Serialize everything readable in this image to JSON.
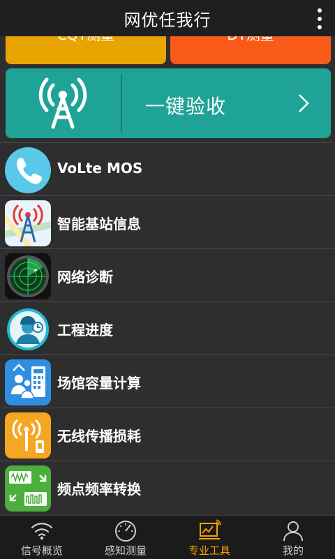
{
  "titlebar": {
    "title": "网优任我行",
    "menu_icon": "more-vert-icon"
  },
  "tiles": [
    {
      "label": "CQT测量",
      "color": "#e8a400"
    },
    {
      "label": "DT测量",
      "color": "#f85a1a"
    }
  ],
  "acceptance": {
    "label": "一键验收",
    "icon": "antenna-tower-icon",
    "color": "#1fa396"
  },
  "tools": [
    {
      "label": "VoLte MOS",
      "icon": "phone-icon"
    },
    {
      "label": "智能基站信息",
      "icon": "base-station-icon"
    },
    {
      "label": "网络诊断",
      "icon": "radar-icon"
    },
    {
      "label": "工程进度",
      "icon": "engineer-icon"
    },
    {
      "label": "场馆容量计算",
      "icon": "venue-capacity-icon"
    },
    {
      "label": "无线传播损耗",
      "icon": "wireless-loss-icon"
    },
    {
      "label": "频点频率转换",
      "icon": "frequency-convert-icon"
    }
  ],
  "bottom_nav": [
    {
      "label": "信号概览",
      "icon": "wifi-signal-icon",
      "active": false
    },
    {
      "label": "感知测量",
      "icon": "speedometer-icon",
      "active": false
    },
    {
      "label": "专业工具",
      "icon": "tools-monitor-icon",
      "active": true
    },
    {
      "label": "我的",
      "icon": "person-icon",
      "active": false
    }
  ],
  "colors": {
    "active_tab": "#f2a300",
    "background": "#2e2e2e"
  }
}
